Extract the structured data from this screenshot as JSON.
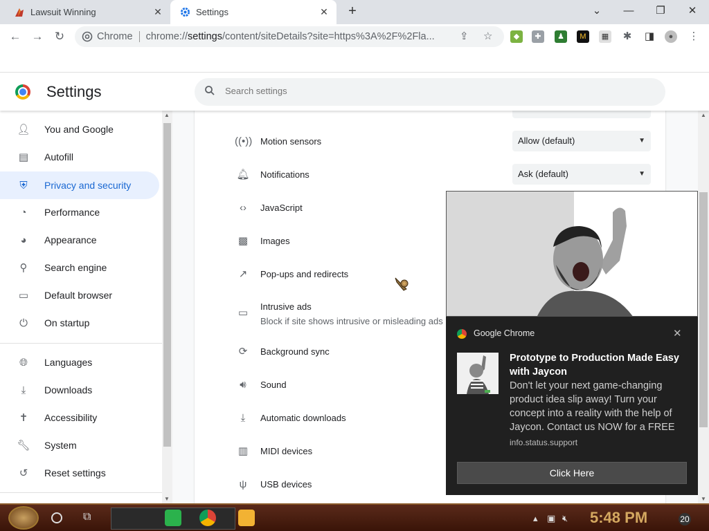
{
  "tabs": [
    {
      "title": "Lawsuit Winning",
      "close": "✕"
    },
    {
      "title": "Settings",
      "close": "✕"
    }
  ],
  "new_tab": "+",
  "window_controls": [
    "⌄",
    "—",
    "❐",
    "✕"
  ],
  "omnibox": {
    "label": "Chrome",
    "url_prefix": "chrome://",
    "url_host": "settings",
    "url_rest": "/content/siteDetails?site=https%3A%2F%2Fla..."
  },
  "settings": {
    "title": "Settings",
    "search_placeholder": "Search settings"
  },
  "sidebar": {
    "items": [
      {
        "label": "You and Google",
        "icon": "person-icon"
      },
      {
        "label": "Autofill",
        "icon": "clipboard-icon"
      },
      {
        "label": "Privacy and security",
        "icon": "shield-icon",
        "active": true
      },
      {
        "label": "Performance",
        "icon": "speedometer-icon"
      },
      {
        "label": "Appearance",
        "icon": "palette-icon"
      },
      {
        "label": "Search engine",
        "icon": "search-icon"
      },
      {
        "label": "Default browser",
        "icon": "browser-icon"
      },
      {
        "label": "On startup",
        "icon": "power-icon"
      },
      {
        "label": "Languages",
        "icon": "globe-icon"
      },
      {
        "label": "Downloads",
        "icon": "download-icon"
      },
      {
        "label": "Accessibility",
        "icon": "accessibility-icon"
      },
      {
        "label": "System",
        "icon": "wrench-icon"
      },
      {
        "label": "Reset settings",
        "icon": "history-icon"
      }
    ]
  },
  "permissions": [
    {
      "label": "Motion sensors",
      "value": "Allow (default)"
    },
    {
      "label": "Notifications",
      "value": "Ask (default)"
    },
    {
      "label": "JavaScript"
    },
    {
      "label": "Images"
    },
    {
      "label": "Pop-ups and redirects"
    },
    {
      "label": "Intrusive ads",
      "sub": "Block if site shows intrusive or misleading ads"
    },
    {
      "label": "Background sync"
    },
    {
      "label": "Sound"
    },
    {
      "label": "Automatic downloads"
    },
    {
      "label": "MIDI devices"
    },
    {
      "label": "USB devices"
    }
  ],
  "notification": {
    "app_name": "Google Chrome",
    "title": "Prototype to Production Made Easy with Jaycon",
    "body": "Don't let your next game-changing product idea slip away! Turn your concept into a reality with the help of Jaycon. Contact us NOW for a FREE cor",
    "source": "info.status.support",
    "action": "Click Here",
    "close": "✕"
  },
  "taskbar": {
    "clock": "5:48 PM",
    "notification_count": "20"
  }
}
